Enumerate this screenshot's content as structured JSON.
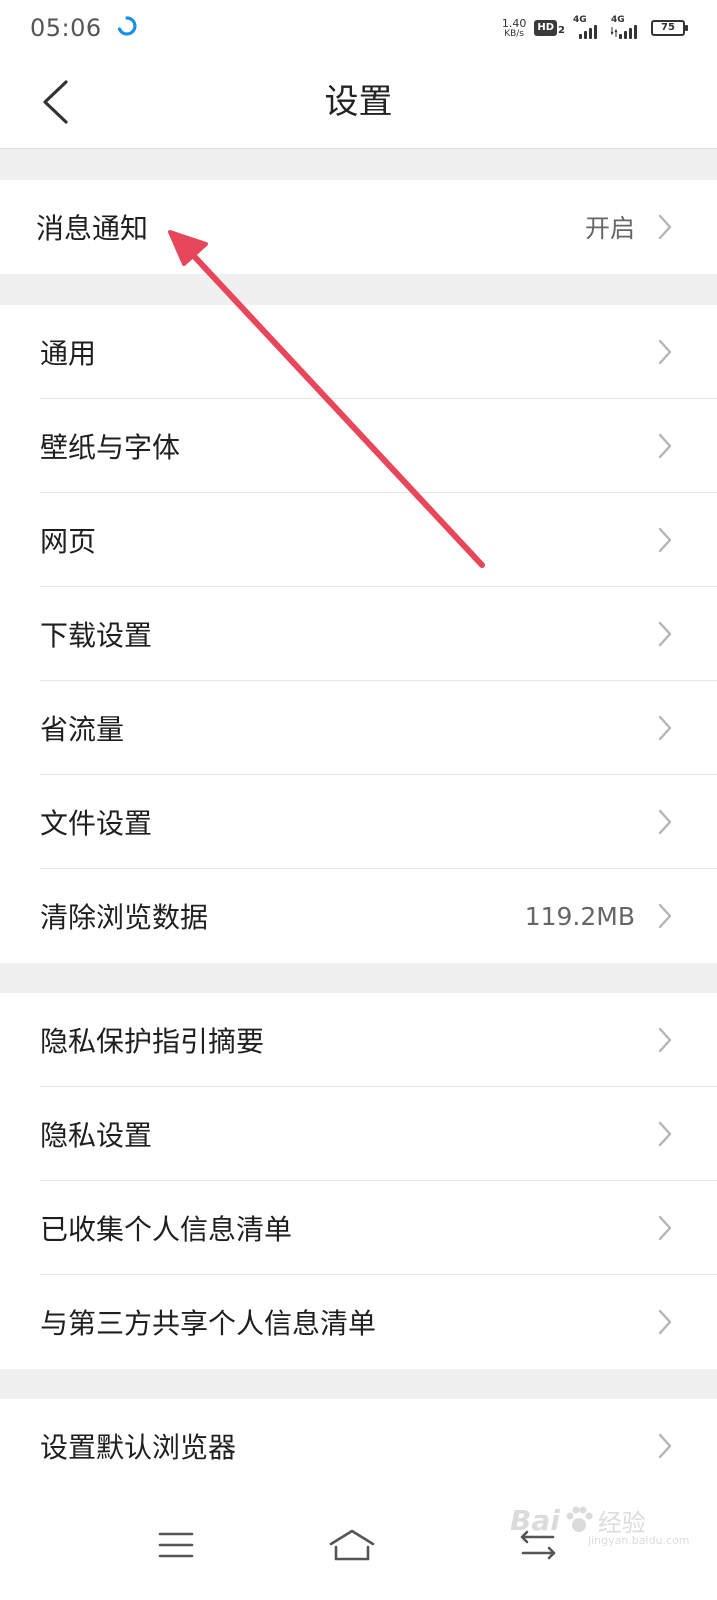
{
  "status_bar": {
    "time": "05:06",
    "net_speed_value": "1.40",
    "net_speed_unit": "KB/s",
    "hd_label": "HD",
    "hd_sub": "2",
    "signal1_label": "4G",
    "signal2_label": "4G",
    "battery_level": "75"
  },
  "header": {
    "title": "设置",
    "back_icon": "chevron-left-icon"
  },
  "groups": [
    {
      "items": [
        {
          "label": "消息通知",
          "value": "开启"
        }
      ]
    },
    {
      "items": [
        {
          "label": "通用",
          "value": ""
        },
        {
          "label": "壁纸与字体",
          "value": ""
        },
        {
          "label": "网页",
          "value": ""
        },
        {
          "label": "下载设置",
          "value": ""
        },
        {
          "label": "省流量",
          "value": ""
        },
        {
          "label": "文件设置",
          "value": ""
        },
        {
          "label": "清除浏览数据",
          "value": "119.2MB"
        }
      ]
    },
    {
      "items": [
        {
          "label": "隐私保护指引摘要",
          "value": ""
        },
        {
          "label": "隐私设置",
          "value": ""
        },
        {
          "label": "已收集个人信息清单",
          "value": ""
        },
        {
          "label": "与第三方共享个人信息清单",
          "value": ""
        }
      ]
    },
    {
      "items": [
        {
          "label": "设置默认浏览器",
          "value": ""
        }
      ]
    }
  ],
  "bottom_nav": {
    "menu_icon": "menu-icon",
    "home_icon": "home-icon",
    "back_icon": "back-switch-icon"
  },
  "watermark": {
    "brand": "Bai",
    "brand_cn": "经验",
    "sub": "jingyan.baidu.com"
  },
  "colors": {
    "background": "#f0f0f0",
    "surface": "#ffffff",
    "text_primary": "#1f1f1f",
    "text_secondary": "#666666",
    "divider": "#e6e6e6",
    "chevron": "#b5b5b5",
    "annotation_arrow": "#e8465a"
  }
}
